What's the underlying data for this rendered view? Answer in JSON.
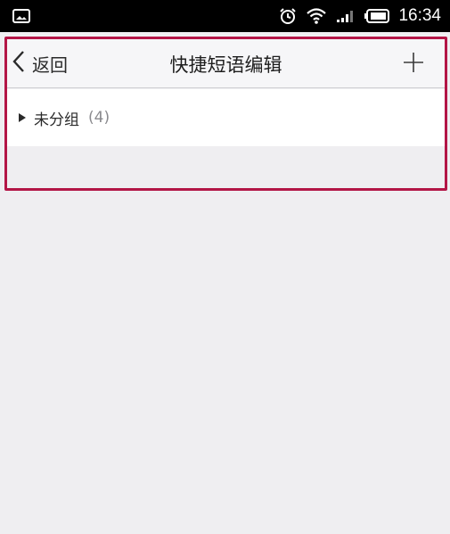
{
  "status_bar": {
    "time": "16:34",
    "icons": [
      "gallery-icon",
      "alarm-icon",
      "wifi-icon",
      "signal-icon",
      "battery-icon"
    ]
  },
  "nav": {
    "back_label": "返回",
    "title": "快捷短语编辑",
    "add_icon": "plus-icon"
  },
  "groups": [
    {
      "name": "未分组",
      "count": "(4)"
    }
  ],
  "colors": {
    "highlight_border": "#b31546",
    "nav_background": "#f6f6f8",
    "page_background": "#efeef1"
  }
}
